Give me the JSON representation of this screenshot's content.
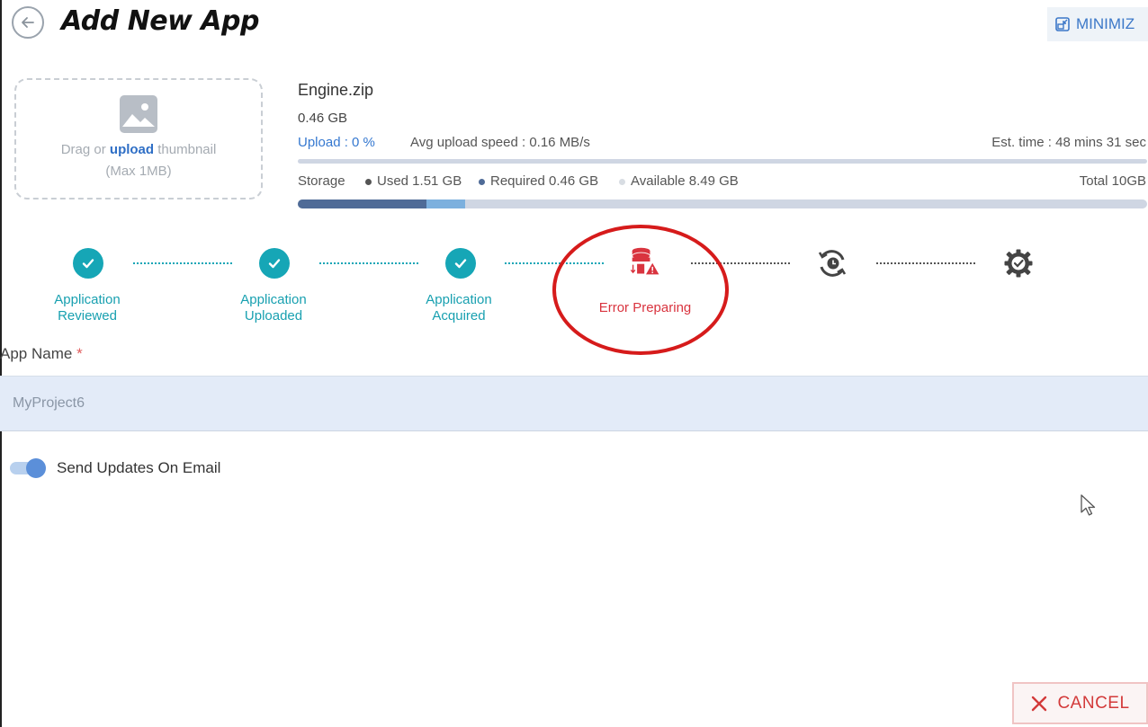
{
  "header": {
    "title": "Add New App",
    "minimize_label": "MINIMIZ"
  },
  "thumbnail": {
    "drag_text": "Drag or",
    "upload_link": "upload",
    "thumbnail_text": "thumbnail",
    "max_size": "(Max 1MB)"
  },
  "file": {
    "name": "Engine.zip",
    "size": "0.46 GB",
    "upload_status": "Upload : 0 %",
    "avg_speed": "Avg upload speed : 0.16 MB/s",
    "est_time": "Est. time : 48 mins 31 sec",
    "upload_progress": 0
  },
  "storage": {
    "label": "Storage",
    "used": "Used 1.51 GB",
    "required": "Required 0.46 GB",
    "available": "Available 8.49 GB",
    "total": "Total 10GB",
    "used_gb": 1.51,
    "required_gb": 0.46,
    "total_gb": 10,
    "colors": {
      "used": "#4f6b97",
      "required": "#7cb0de",
      "available": "#cfd6e3"
    }
  },
  "steps": [
    {
      "label_line1": "Application",
      "label_line2": "Reviewed",
      "status": "done",
      "icon": "check-circle-icon"
    },
    {
      "label_line1": "Application",
      "label_line2": "Uploaded",
      "status": "done",
      "icon": "check-circle-icon"
    },
    {
      "label_line1": "Application",
      "label_line2": "Acquired",
      "status": "done",
      "icon": "check-circle-icon"
    },
    {
      "label_line1": "Error Preparing",
      "label_line2": "",
      "status": "error",
      "icon": "database-error-icon"
    },
    {
      "label_line1": "",
      "label_line2": "",
      "status": "pending",
      "icon": "sync-clock-icon"
    },
    {
      "label_line1": "",
      "label_line2": "",
      "status": "pending",
      "icon": "gear-check-icon"
    }
  ],
  "form": {
    "app_name_label": "App Name",
    "required_marker": "*",
    "app_name_value": "MyProject6",
    "email_updates_label": "Send Updates On Email",
    "email_updates_on": true
  },
  "footer": {
    "cancel_label": "CANCEL"
  },
  "colors": {
    "accent_teal": "#16a6b6",
    "error_red": "#d9343f",
    "link_blue": "#3578d0",
    "highlight_ring": "#d61b1b"
  }
}
